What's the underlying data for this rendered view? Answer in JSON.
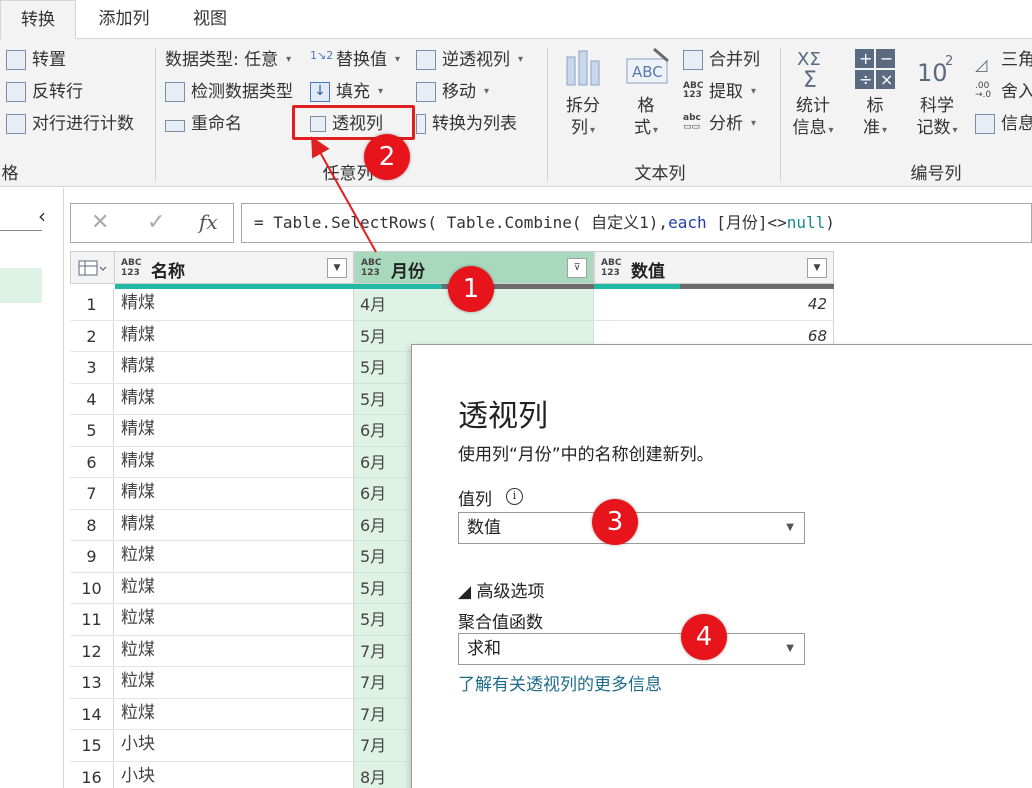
{
  "tabs": [
    {
      "label": "转换",
      "active": true
    },
    {
      "label": "添加列",
      "active": false
    },
    {
      "label": "视图",
      "active": false
    }
  ],
  "ribbon": {
    "table_group": {
      "transpose": "转置",
      "reverse_rows": "反转行",
      "count_rows": "对行进行计数",
      "group_label_partial": "格"
    },
    "any_column_group": {
      "data_type": "数据类型: 任意",
      "detect_type": "检测数据类型",
      "rename": "重命名",
      "replace_values": "替换值",
      "fill": "填充",
      "pivot_column": "透视列",
      "unpivot": "逆透视列",
      "move": "移动",
      "to_list": "转换为列表",
      "group_label": "任意列"
    },
    "text_group": {
      "split_column_l1": "拆分",
      "split_column_l2": "列",
      "format_l1": "格",
      "format_l2": "式",
      "merge_columns": "合并列",
      "extract": "提取",
      "parse": "分析",
      "group_label": "文本列"
    },
    "number_group": {
      "statistics_l1": "统计",
      "statistics_l2": "信息",
      "standard_l1": "标",
      "standard_l2": "准",
      "scientific_l1": "科学",
      "scientific_l2": "记数",
      "trig_partial": "三角",
      "round_partial": "舍入",
      "info_partial": "信息",
      "group_label": "编号列"
    }
  },
  "formula_bar": {
    "cancel": "✕",
    "confirm": "✓",
    "fx": "fx",
    "formula_prefix": "= Table.SelectRows( Table.Combine( 自定义1),",
    "formula_each": "each",
    "formula_mid": " [月份]<>",
    "formula_null": "null",
    "formula_suffix": ")"
  },
  "grid": {
    "type_badge_top": "ABC",
    "type_badge_bottom": "123",
    "columns": [
      "名称",
      "月份",
      "数值"
    ],
    "rows": [
      {
        "n": "1",
        "name": "精煤",
        "month": "4月",
        "value": "42"
      },
      {
        "n": "2",
        "name": "精煤",
        "month": "5月",
        "value": "68"
      },
      {
        "n": "3",
        "name": "精煤",
        "month": "5月",
        "value": ""
      },
      {
        "n": "4",
        "name": "精煤",
        "month": "5月",
        "value": ""
      },
      {
        "n": "5",
        "name": "精煤",
        "month": "6月",
        "value": ""
      },
      {
        "n": "6",
        "name": "精煤",
        "month": "6月",
        "value": ""
      },
      {
        "n": "7",
        "name": "精煤",
        "month": "6月",
        "value": ""
      },
      {
        "n": "8",
        "name": "精煤",
        "month": "6月",
        "value": ""
      },
      {
        "n": "9",
        "name": "粒煤",
        "month": "5月",
        "value": ""
      },
      {
        "n": "10",
        "name": "粒煤",
        "month": "5月",
        "value": ""
      },
      {
        "n": "11",
        "name": "粒煤",
        "month": "5月",
        "value": ""
      },
      {
        "n": "12",
        "name": "粒煤",
        "month": "7月",
        "value": ""
      },
      {
        "n": "13",
        "name": "粒煤",
        "month": "7月",
        "value": ""
      },
      {
        "n": "14",
        "name": "粒煤",
        "month": "7月",
        "value": ""
      },
      {
        "n": "15",
        "name": "小块",
        "month": "7月",
        "value": ""
      },
      {
        "n": "16",
        "name": "小块",
        "month": "8月",
        "value": ""
      }
    ]
  },
  "dialog": {
    "title": "透视列",
    "description": "使用列“月份”中的名称创建新列。",
    "values_label": "值列",
    "values_selected": "数值",
    "advanced_label": "◢ 高级选项",
    "aggregate_label": "聚合值函数",
    "aggregate_selected": "求和",
    "learn_more": "了解有关透视列的更多信息"
  },
  "callouts": [
    "1",
    "2",
    "3",
    "4"
  ],
  "colors": {
    "highlight_red": "#e02020",
    "badge_red": "#e8141b",
    "selected_column": "#dff2e6",
    "selected_header": "#a9d9bd",
    "quality_bar": "#21b8a4",
    "link": "#1e6c8c"
  }
}
